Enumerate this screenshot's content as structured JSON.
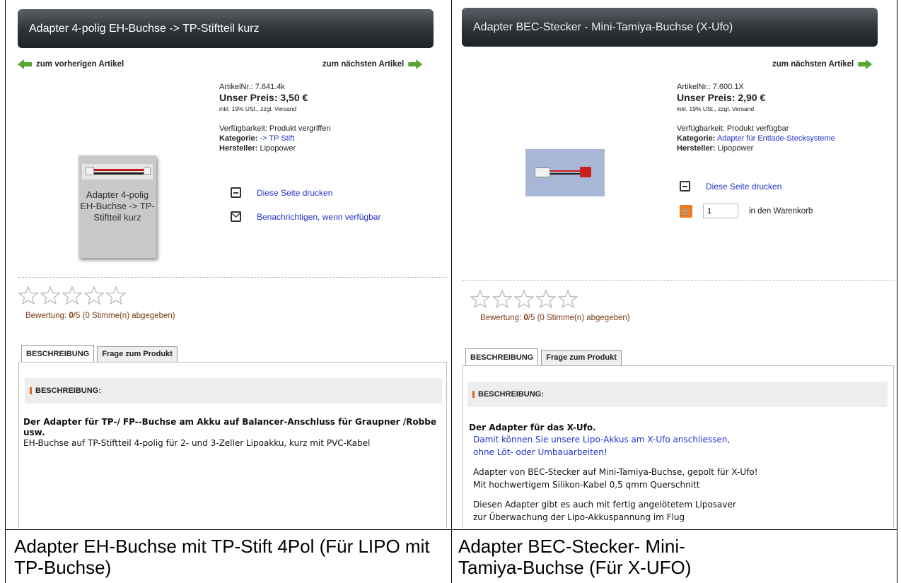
{
  "left": {
    "title": "Adapter 4-polig EH-Buchse -> TP-Stiftteil kurz",
    "prev_link": "zum vorherigen Artikel",
    "next_link": "zum nächsten Artikel",
    "article_no": "ArtikelNr.: 7.641.4k",
    "price": "Unser Preis: 3,50 €",
    "vat_note": "inkl. 19% USt., zzgl. Versand",
    "availability": "Verfügbarkeit: Produkt vergriffen",
    "category_label": "Kategorie:",
    "category_value": "-> TP Stift",
    "manufacturer_label": "Hersteller:",
    "manufacturer_value": "Lipopower",
    "image_caption": "Adapter 4-polig EH-Buchse -> TP-Stiftteil kurz",
    "print_label": "Diese Seite drucken",
    "notify_label": "Benachrichtigen, wenn verfügbar",
    "rating_prefix": "Bewertung: ",
    "rating_value": "0",
    "rating_suffix": "/5 (0 Stimme(n) abgegeben)",
    "tab_description": "BESCHREIBUNG",
    "tab_question": "Frage zum Produkt",
    "section_heading": "BESCHREIBUNG:",
    "desc_bold": "Der Adapter für TP-/ FP--Buchse am Akku auf Balancer-Anschluss für Graupner /Robbe usw.",
    "desc_text": "EH-Buchse auf TP-Stiftteil 4-polig für 2- und 3-Zeller Lipoakku, kurz mit PVC-Kabel"
  },
  "right": {
    "title": "Adapter BEC-Stecker - Mini-Tamiya-Buchse (X-Ufo)",
    "next_link": "zum nächsten Artikel",
    "article_no": "ArtikelNr.: 7.600.1X",
    "price": "Unser Preis: 2,90 €",
    "vat_note": "inkl. 19% USt., zzgl. Versand",
    "availability": "Verfügbarkeit: Produkt verfügbar",
    "category_label": "Kategorie:",
    "category_value": "Adapter für Entlade-Stecksysteme",
    "manufacturer_label": "Hersteller:",
    "manufacturer_value": "Lipopower",
    "print_label": "Diese Seite drucken",
    "quantity": "1",
    "cart_label": "in den Warenkorb",
    "rating_prefix": "Bewertung: ",
    "rating_value": "0",
    "rating_suffix": "/5 (0 Stimme(n) abgegeben)",
    "tab_description": "BESCHREIBUNG",
    "tab_question": "Frage zum Produkt",
    "section_heading": "BESCHREIBUNG:",
    "desc_bold": "Der Adapter für das X-Ufo.",
    "desc_blue_1": "Damit können Sie unsere Lipo-Akkus am X-Ufo anschliessen,",
    "desc_blue_2": "ohne Löt- oder Umbauarbeiten!",
    "desc_p2_1": "Adapter von BEC-Stecker auf Mini-Tamiya-Buchse, gepolt für X-Ufo!",
    "desc_p2_2": "Mit hochwertigem Silikon-Kabel 0,5 qmm Querschnitt",
    "desc_p3_1": "Diesen Adapter gibt es auch mit fertig angelötetem Liposaver",
    "desc_p3_2": "zur Überwachung der Lipo-Akkuspannung im Flug"
  },
  "captions": {
    "left": "Adapter EH-Buchse mit TP-Stift 4Pol (Für LIPO mit TP-Buchse)",
    "right": "Adapter BEC-Stecker- Mini-Tamiya-Buchse (Für X-UFO)"
  },
  "colors": {
    "nav_arrow": "#5aa634",
    "link": "#2233cc",
    "rating_text": "#7a3a14",
    "cart_icon": "#f07a1e",
    "section_marker": "#e0641c"
  }
}
